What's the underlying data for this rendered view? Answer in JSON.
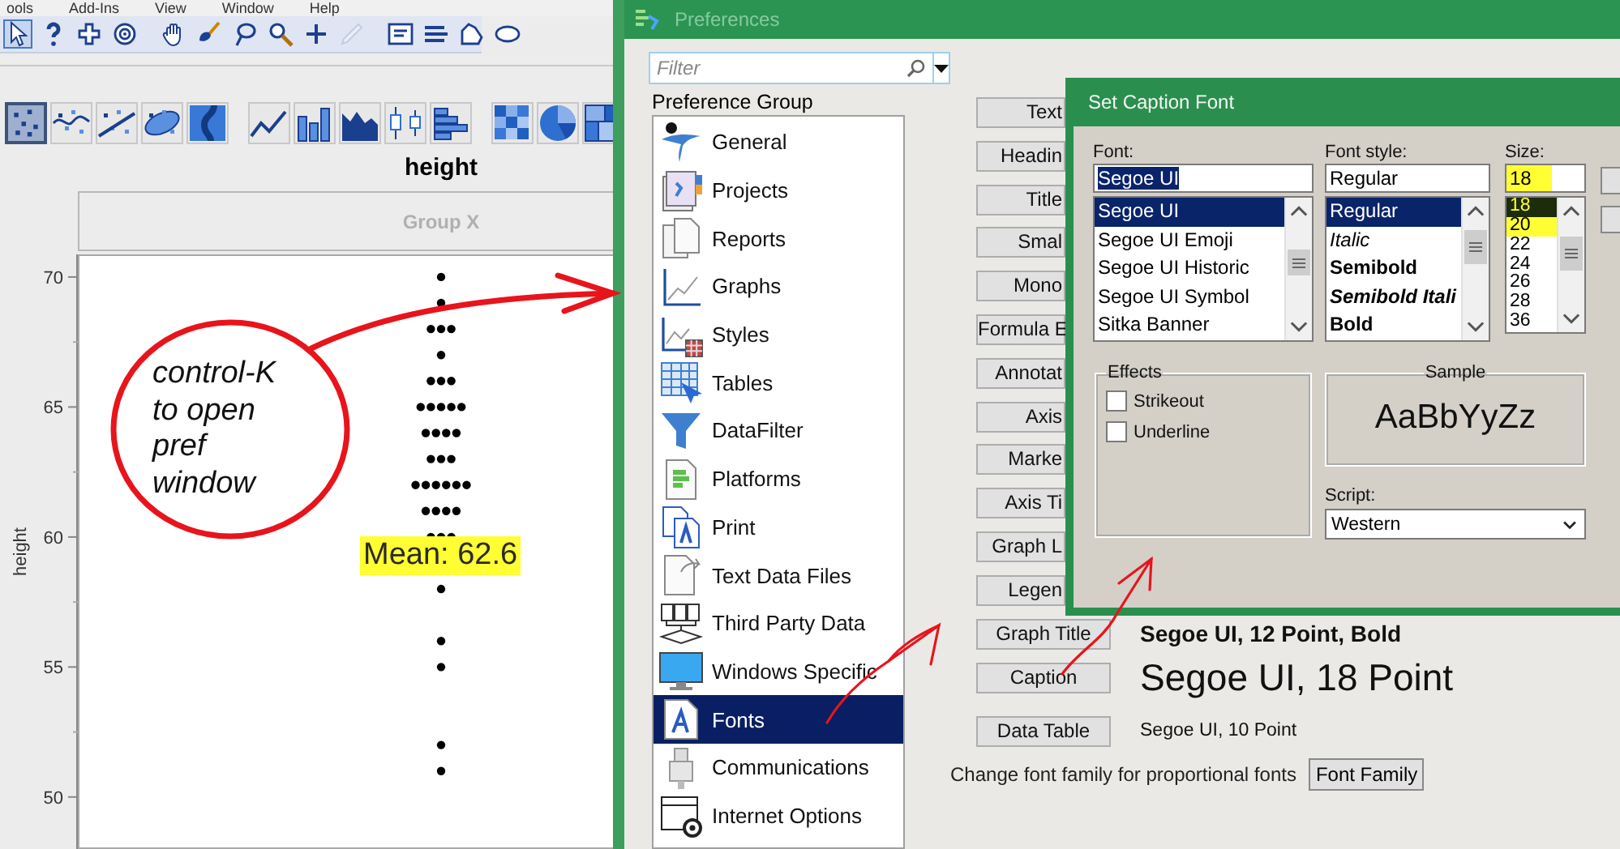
{
  "app_window": {
    "menu": [
      "ools",
      "Add-Ins",
      "View",
      "Window",
      "Help"
    ],
    "toolbar": [
      {
        "selected": true,
        "disabled": false
      },
      {
        "selected": false,
        "disabled": false
      },
      {
        "selected": false,
        "disabled": false
      },
      {
        "selected": false,
        "disabled": false
      },
      {
        "selected": false,
        "disabled": false
      },
      {
        "selected": false,
        "disabled": false
      },
      {
        "selected": false,
        "disabled": false
      },
      {
        "selected": false,
        "disabled": false
      },
      {
        "selected": false,
        "disabled": false
      },
      {
        "selected": false,
        "disabled": true
      },
      {
        "selected": false,
        "disabled": false
      },
      {
        "selected": false,
        "disabled": false
      },
      {
        "selected": false,
        "disabled": false
      },
      {
        "selected": false,
        "disabled": false
      }
    ],
    "chart_types": [
      {
        "selected": true
      },
      {
        "selected": false
      },
      {
        "selected": false
      },
      {
        "selected": false
      },
      {
        "selected": false
      },
      {
        "selected": false
      },
      {
        "selected": false
      },
      {
        "selected": false
      },
      {
        "selected": false
      },
      {
        "selected": false
      },
      {
        "selected": false
      },
      {
        "selected": false
      },
      {
        "selected": false
      }
    ],
    "chart": {
      "title": "height",
      "group": "Group X",
      "y_label": "height",
      "y_ticks": [
        "70",
        "65",
        "60",
        "55",
        "50"
      ],
      "mean_label": {
        "text": "Mean: 62.6",
        "highlighted": true
      }
    }
  },
  "annotation": {
    "note": "control-K to open pref window"
  },
  "preferences": {
    "title": "Preferences",
    "filter": {
      "placeholder": "Filter"
    },
    "group_label": "Preference Group",
    "groups": [
      {
        "label": "General",
        "selected": false
      },
      {
        "label": "Projects",
        "selected": false
      },
      {
        "label": "Reports",
        "selected": false
      },
      {
        "label": "Graphs",
        "selected": false
      },
      {
        "label": "Styles",
        "selected": false
      },
      {
        "label": "Tables",
        "selected": false
      },
      {
        "label": "DataFilter",
        "selected": false
      },
      {
        "label": "Platforms",
        "selected": false
      },
      {
        "label": "Print",
        "selected": false
      },
      {
        "label": "Text Data Files",
        "selected": false
      },
      {
        "label": "Third Party Data",
        "selected": false
      },
      {
        "label": "Windows Specific",
        "selected": false
      },
      {
        "label": "Fonts",
        "selected": true
      },
      {
        "label": "Communications",
        "selected": false
      },
      {
        "label": "Internet Options",
        "selected": false
      }
    ],
    "font_buttons": [
      "Text",
      "Headin",
      "Title",
      "Smal",
      "Mono",
      "Formula E",
      "Annotat",
      "Axis",
      "Marke",
      "Axis Ti",
      "Graph L",
      "Legen"
    ],
    "font_settings": [
      {
        "button": "Graph Title",
        "description": "Segoe UI, 12 Point, Bold",
        "kind": "bold"
      },
      {
        "button": "Caption",
        "description": "Segoe UI, 18 Point",
        "kind": "large"
      },
      {
        "button": "Data Table",
        "description": "Segoe UI, 10 Point",
        "kind": "small"
      }
    ],
    "family_row": {
      "text": "Change font family for proportional fonts",
      "button": "Font Family"
    }
  },
  "dialog": {
    "title": "Set Caption Font",
    "font": {
      "label": "Font:",
      "value": "Segoe UI",
      "text_selected": true,
      "items": [
        {
          "label": "Segoe UI",
          "selected": true
        },
        {
          "label": "Segoe UI Emoji",
          "selected": false
        },
        {
          "label": "Segoe UI Historic",
          "selected": false
        },
        {
          "label": "Segoe UI Symbol",
          "selected": false
        },
        {
          "label": "Sitka Banner",
          "selected": false
        }
      ]
    },
    "style": {
      "label": "Font style:",
      "value": "Regular",
      "items": [
        {
          "label": "Regular",
          "kind": "regular",
          "selected": true
        },
        {
          "label": "Italic",
          "kind": "italic",
          "selected": false
        },
        {
          "label": "Semibold",
          "kind": "bold",
          "selected": false
        },
        {
          "label": "Semibold Itali",
          "kind": "bold-italic",
          "selected": false
        },
        {
          "label": "Bold",
          "kind": "bold",
          "selected": false
        }
      ]
    },
    "size": {
      "label": "Size:",
      "value": "18",
      "highlighted": true,
      "items": [
        {
          "label": "18",
          "selected": true,
          "highlighted": true
        },
        {
          "label": "20",
          "selected": false,
          "highlighted": true
        },
        {
          "label": "22",
          "selected": false,
          "highlighted": false
        },
        {
          "label": "24",
          "selected": false,
          "highlighted": false
        },
        {
          "label": "26",
          "selected": false,
          "highlighted": false
        },
        {
          "label": "28",
          "selected": false,
          "highlighted": false
        },
        {
          "label": "36",
          "selected": false,
          "highlighted": false
        }
      ]
    },
    "effects": {
      "label": "Effects",
      "options": [
        {
          "label": "Strikeout",
          "checked": false
        },
        {
          "label": "Underline",
          "checked": false
        }
      ]
    },
    "sample": {
      "label": "Sample",
      "text": "AaBbYyZz"
    },
    "script": {
      "label": "Script:",
      "value": "Western"
    }
  }
}
